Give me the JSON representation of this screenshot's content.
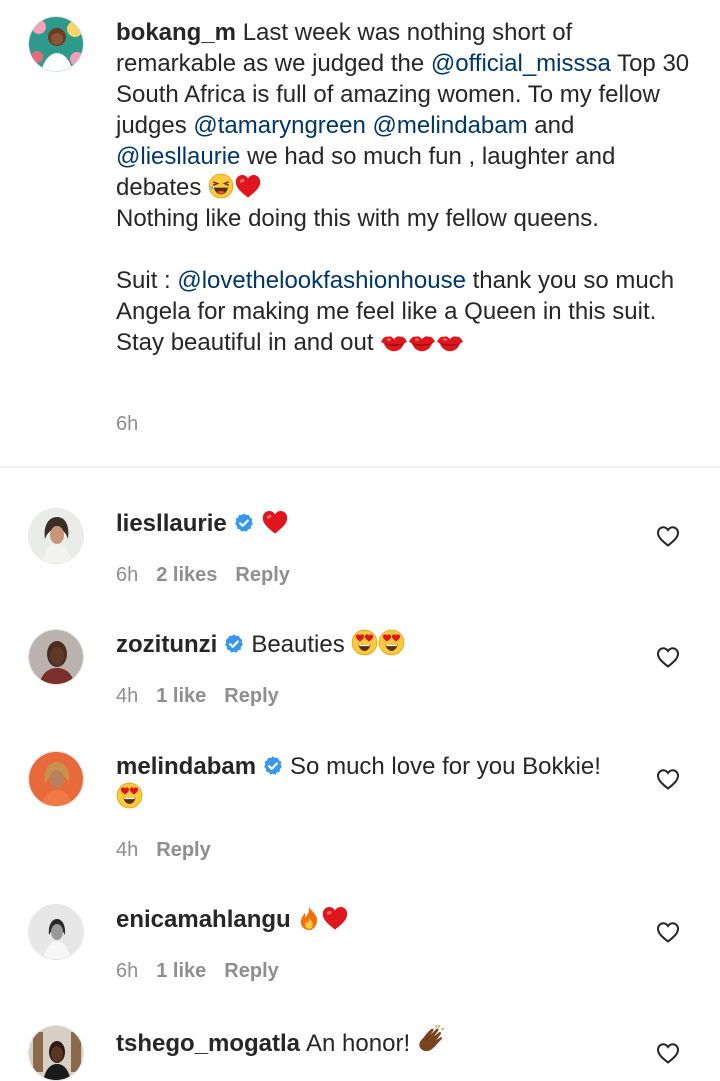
{
  "caption": {
    "username": "bokang_m",
    "text_1": "Last week was nothing short of remarkable as we judged the ",
    "mention_1": "@official_misssa",
    "text_2": " Top 30",
    "text_3": "South Africa is full of amazing women. To my fellow judges ",
    "mention_2": "@tamaryngreen",
    "mention_3": "@melindabam",
    "text_4": " and ",
    "mention_4": "@liesllaurie",
    "text_5": " we had so much fun , laughter and debates",
    "text_6": "Nothing like doing this with my fellow queens.",
    "text_7": "Suit : ",
    "mention_5": "@lovethelookfashionhouse",
    "text_8": " thank you so much Angela for making me feel like a Queen in this suit. Stay beautiful in and out",
    "time": "6h"
  },
  "comments": [
    {
      "username": "liesllaurie",
      "text": "",
      "time": "6h",
      "likes": "2 likes",
      "reply": "Reply"
    },
    {
      "username": "zozitunzi",
      "text": "Beauties",
      "time": "4h",
      "likes": "1 like",
      "reply": "Reply"
    },
    {
      "username": "melindabam",
      "text": "So much love for you Bokkie!",
      "time": "4h",
      "likes": "",
      "reply": "Reply"
    },
    {
      "username": "enicamahlangu",
      "text": "",
      "time": "6h",
      "likes": "1 like",
      "reply": "Reply"
    },
    {
      "username": "tshego_mogatla",
      "text": "An honor!",
      "time": "",
      "likes": "",
      "reply": ""
    }
  ],
  "icons": {
    "verified": "verified-badge-icon",
    "like": "heart-outline-icon",
    "emoji_heart": "red-heart-emoji",
    "emoji_laugh": "laughing-emoji",
    "emoji_lips": "kiss-lips-emoji",
    "emoji_heart_eyes": "heart-eyes-emoji",
    "emoji_fire": "fire-emoji",
    "emoji_clap": "clapping-hands-emoji"
  },
  "colors": {
    "text": "#262626",
    "muted": "#8e8e8e",
    "mention": "#00376b",
    "verified": "#3897f0",
    "divider": "#efefef"
  }
}
